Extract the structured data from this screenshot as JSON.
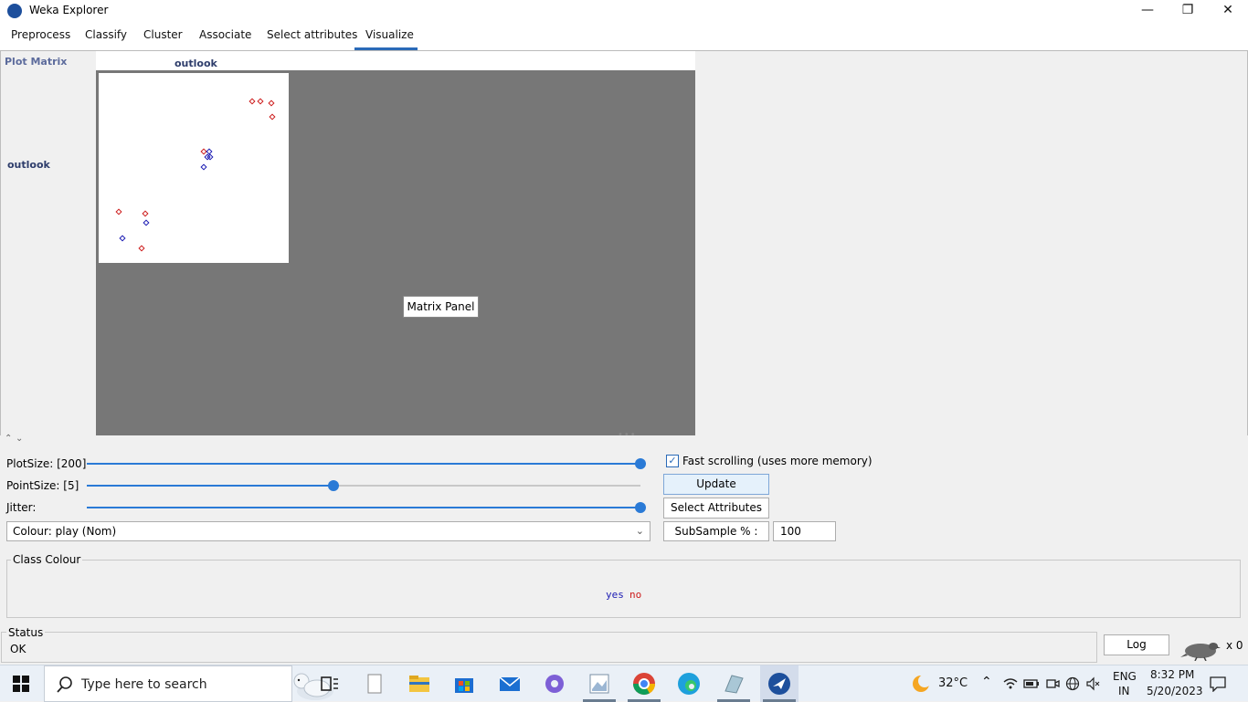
{
  "window": {
    "title": "Weka Explorer",
    "minimize": "—",
    "maximize": "❐",
    "close": "✕"
  },
  "tabs": [
    {
      "label": "Preprocess"
    },
    {
      "label": "Classify"
    },
    {
      "label": "Cluster"
    },
    {
      "label": "Associate"
    },
    {
      "label": "Select attributes"
    },
    {
      "label": "Visualize",
      "active": true
    }
  ],
  "matrix": {
    "title": "Plot Matrix",
    "column_attribute": "outlook",
    "row_attribute": "outlook",
    "tooltip": "Matrix Panel",
    "points": [
      {
        "c": "no"
      },
      {
        "c": "no"
      },
      {
        "c": "no"
      },
      {
        "c": "no"
      },
      {
        "c": "no"
      },
      {
        "c": "yes"
      },
      {
        "c": "yes"
      },
      {
        "c": "yes"
      },
      {
        "c": "yes"
      },
      {
        "c": "no"
      },
      {
        "c": "no"
      },
      {
        "c": "yes"
      },
      {
        "c": "yes"
      },
      {
        "c": "no"
      }
    ]
  },
  "controls": {
    "plot_size_label": "PlotSize: [200]",
    "plot_size": 200,
    "plot_size_fraction": 1.0,
    "point_size_label": "PointSize: [5]",
    "point_size": 5,
    "point_size_fraction": 0.446,
    "jitter_label": "Jitter:",
    "jitter_fraction": 1.0,
    "colour_select": "Colour: play  (Nom)",
    "fast_scrolling_label": "Fast scrolling (uses more memory)",
    "fast_scrolling_checked": true,
    "update_button": "Update",
    "select_attributes_button": "Select Attributes",
    "subsample_button": "SubSample % :",
    "subsample_value": "100"
  },
  "class_colour": {
    "title": "Class Colour",
    "legend": [
      {
        "label": "yes",
        "color": "#1b1bb3"
      },
      {
        "label": "no",
        "color": "#cc1b1b"
      }
    ]
  },
  "status": {
    "title": "Status",
    "text": "OK",
    "log_button": "Log",
    "task_count": "x 0"
  },
  "taskbar": {
    "search_placeholder": "Type here to search",
    "weather": "32°C",
    "language": "ENG",
    "region": "IN",
    "time": "8:32 PM",
    "date": "5/20/2023"
  },
  "colors": {
    "accent": "#2a7ad6",
    "class_yes": "#1b1bb3",
    "class_no": "#cc1b1b",
    "matrix_bg": "#777777"
  }
}
